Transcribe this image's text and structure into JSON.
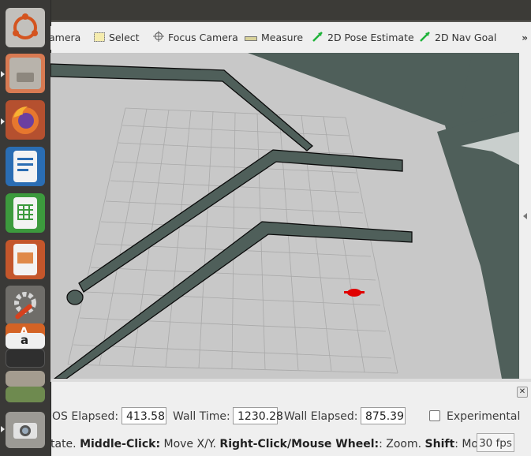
{
  "toolbar": {
    "tools": [
      {
        "label": "amera",
        "icon": "camera-icon"
      },
      {
        "label": "Select",
        "icon": "select-icon"
      },
      {
        "label": "Focus Camera",
        "icon": "focus-camera-icon"
      },
      {
        "label": "Measure",
        "icon": "measure-icon"
      },
      {
        "label": "2D Pose Estimate",
        "icon": "pose-estimate-icon"
      },
      {
        "label": "2D Nav Goal",
        "icon": "nav-goal-icon"
      }
    ],
    "more": "»"
  },
  "launcher": {
    "items": [
      "ubuntu-dash-icon",
      "files-icon",
      "firefox-icon",
      "writer-icon",
      "calc-icon",
      "impress-icon",
      "system-settings-icon",
      "software-center-icon",
      "amazon-icon",
      "stacked-apps-icon",
      "camera-app-icon"
    ]
  },
  "time": {
    "ros_elapsed_label": "OS Elapsed:",
    "ros_elapsed": "413.58",
    "wall_time_label": "Wall Time:",
    "wall_time": "1230.28",
    "wall_elapsed_label": "Wall Elapsed:",
    "wall_elapsed": "875.39",
    "experimental_label": "Experimental"
  },
  "status": {
    "part1": "tate. ",
    "b1": "Middle-Click:",
    "part2": " Move X/Y. ",
    "b2": "Right-Click/Mouse Wheel:",
    "part3": ": Zoom. ",
    "b3": "Shift",
    "part4": ": More op"
  },
  "fps": "30 fps",
  "colors": {
    "map_free": "#c8c8c8",
    "map_unknown": "#4f5f5a",
    "grid": "#a9a9a9",
    "robot": "#e00000"
  }
}
